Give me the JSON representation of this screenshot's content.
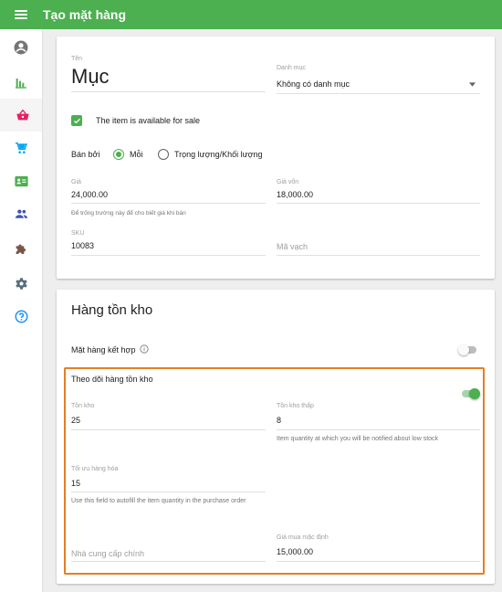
{
  "app": {
    "title": "Tạo mặt hàng"
  },
  "colors": {
    "primary": "#4caf50",
    "accent": "#e91e63",
    "highlight": "#e67e22"
  },
  "sidebar": {
    "items": [
      {
        "name": "account",
        "icon": "account-circle-icon"
      },
      {
        "name": "reports",
        "icon": "bar-chart-icon"
      },
      {
        "name": "items",
        "icon": "basket-icon",
        "active": true
      },
      {
        "name": "sales",
        "icon": "cart-icon"
      },
      {
        "name": "employees",
        "icon": "badge-icon"
      },
      {
        "name": "customers",
        "icon": "people-icon"
      },
      {
        "name": "integrations",
        "icon": "puzzle-icon"
      },
      {
        "name": "settings",
        "icon": "gear-icon"
      },
      {
        "name": "help",
        "icon": "help-icon"
      }
    ]
  },
  "item": {
    "name_label": "Tên",
    "name_value": "Mục",
    "category_label": "Danh mục",
    "category_value": "Không có danh mục",
    "available_label": "The item is available for sale",
    "sold_by_label": "Bán bởi",
    "sold_by_options": [
      "Mỗi",
      "Trọng lượng/Khối lượng"
    ],
    "sold_by_selected": "Mỗi",
    "price_label": "Giá",
    "price_value": "24,000.00",
    "price_hint": "Để trống trường này để cho biết giá khi bán",
    "cost_label": "Giá vốn",
    "cost_value": "18,000.00",
    "sku_label": "SKU",
    "sku_value": "10083",
    "barcode_placeholder": "Mã vạch"
  },
  "inventory": {
    "title": "Hàng tồn kho",
    "composite_label": "Mặt hàng kết hợp",
    "composite_on": false,
    "track_label": "Theo dõi hàng tồn kho",
    "track_on": true,
    "in_stock_label": "Tồn kho",
    "in_stock_value": "25",
    "low_stock_label": "Tồn kho thấp",
    "low_stock_value": "8",
    "low_stock_hint": "Item quantity at which you will be notified about low stock",
    "optimal_label": "Tối ưu hàng hóa",
    "optimal_value": "15",
    "optimal_hint": "Use this field to autofill the item quantity in the purchase order",
    "supplier_placeholder": "Nhà cung cấp chính",
    "default_cost_label": "Giá mua mặc định",
    "default_cost_value": "15,000.00"
  }
}
